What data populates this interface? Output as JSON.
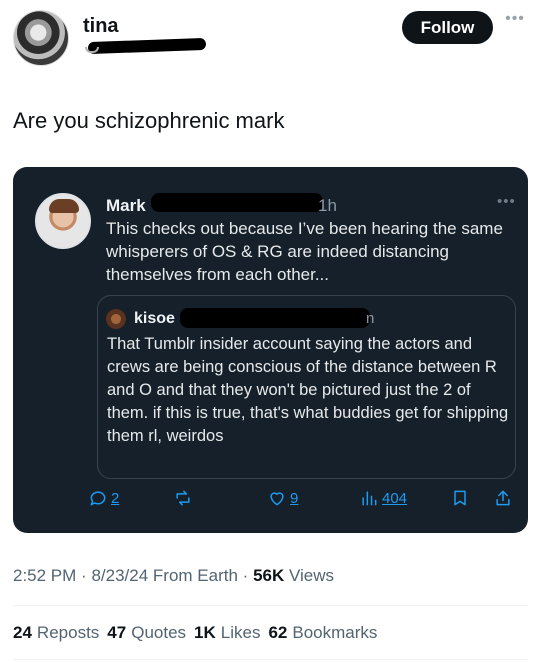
{
  "author": {
    "name": "tina"
  },
  "follow_label": "Follow",
  "tweet_text": "Are you schizophrenic mark",
  "quoted": {
    "name": "Mark",
    "time": "1h",
    "text": "This checks out because I’ve been hearing the same whisperers of OS & RG are indeed distancing themselves from each other...",
    "inner": {
      "name": "kisoe",
      "time": "n",
      "text": "That Tumblr insider account saying the actors and crews are being conscious of the distance between R and O and that they won't be pictured just the 2 of them. if this is true, that's what buddies get for shipping them rl, weirdos"
    },
    "actions": {
      "replies": "2",
      "likes": "9",
      "views": "404"
    }
  },
  "meta": {
    "time": "2:52 PM",
    "date": "8/23/24",
    "source": "From Earth",
    "views_count": "56K",
    "views_label": "Views"
  },
  "stats": {
    "reposts_count": "24",
    "reposts_label": "Reposts",
    "quotes_count": "47",
    "quotes_label": "Quotes",
    "likes_count": "1K",
    "likes_label": "Likes",
    "bookmarks_count": "62",
    "bookmarks_label": "Bookmarks"
  },
  "icons": [
    "more-icon",
    "reply-icon",
    "repost-icon",
    "like-icon",
    "views-icon",
    "bookmark-icon",
    "share-icon"
  ],
  "colors": {
    "accent": "#1d9bf0",
    "card_bg": "#15202b",
    "follow_bg": "#0f1419"
  }
}
